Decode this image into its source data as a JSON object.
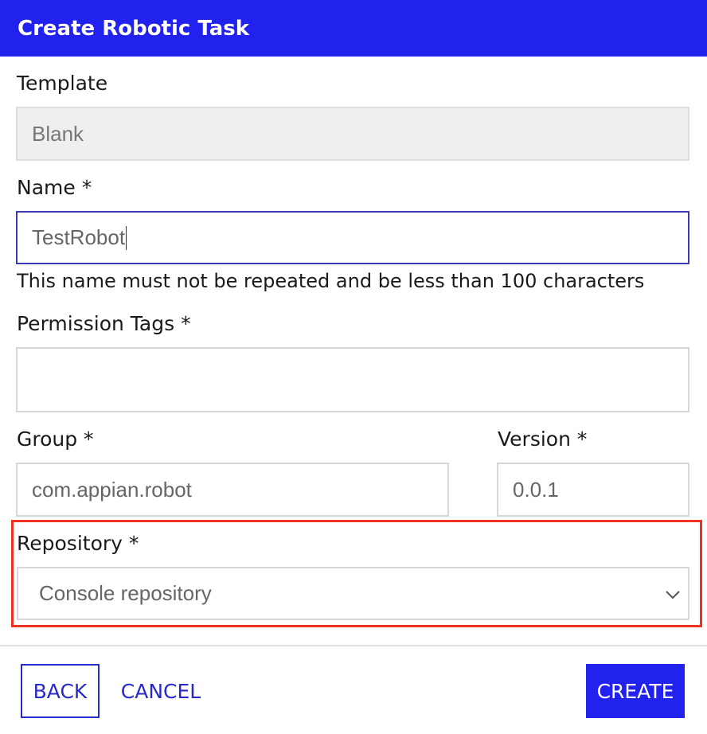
{
  "dialog": {
    "title": "Create Robotic Task"
  },
  "form": {
    "template": {
      "label": "Template",
      "value": "Blank"
    },
    "name": {
      "label": "Name *",
      "value": "TestRobot",
      "help": "This name must not be repeated and be less than 100 characters"
    },
    "permission_tags": {
      "label": "Permission Tags *",
      "value": ""
    },
    "group": {
      "label": "Group *",
      "value": "com.appian.robot"
    },
    "version": {
      "label": "Version *",
      "value": "0.0.1"
    },
    "repository": {
      "label": "Repository *",
      "selected": "Console repository"
    }
  },
  "footer": {
    "back_label": "BACK",
    "cancel_label": "CANCEL",
    "create_label": "CREATE"
  },
  "colors": {
    "primary": "#2222ee",
    "highlight": "#ee3322"
  },
  "icons": {
    "select": "chevron-down-icon"
  }
}
